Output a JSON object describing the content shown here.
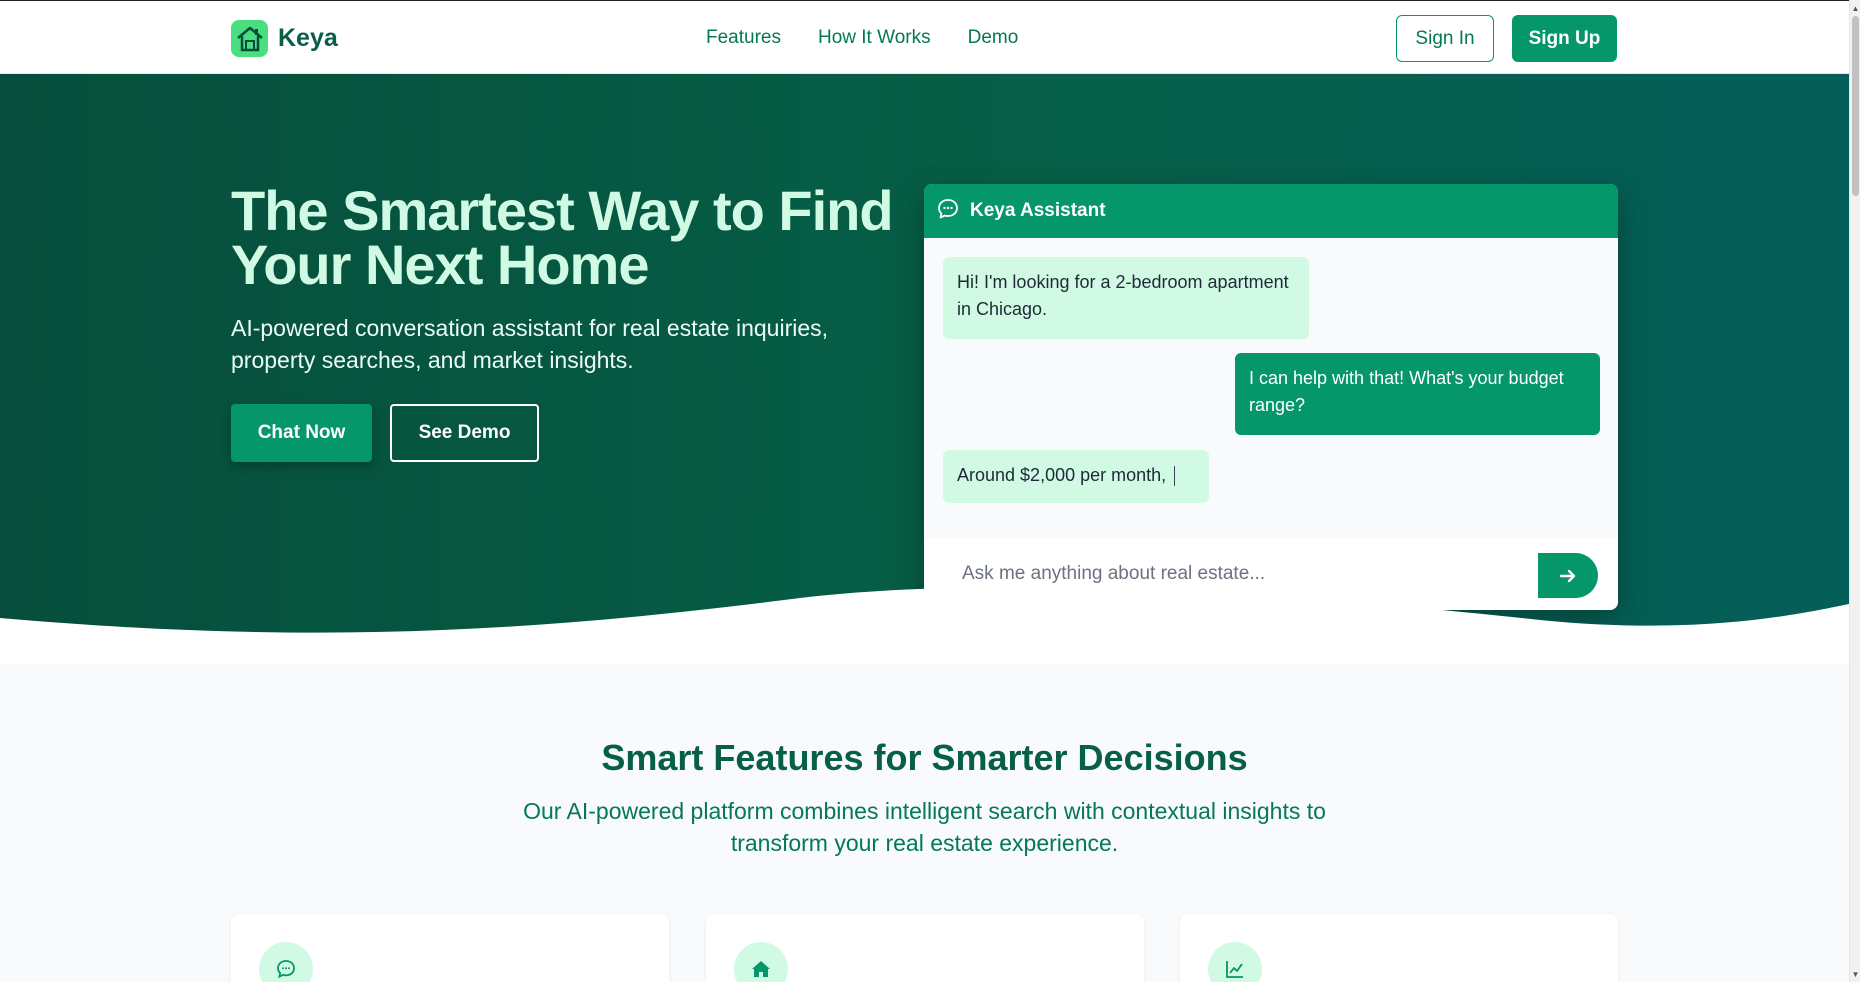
{
  "brand": {
    "name": "Keya",
    "logo_icon": "house-logo-icon"
  },
  "nav": {
    "links": [
      "Features",
      "How It Works",
      "Demo"
    ],
    "sign_in": "Sign In",
    "sign_up": "Sign Up"
  },
  "hero": {
    "title": "The Smartest Way to Find Your Next Home",
    "subtitle": "AI-powered conversation assistant for real estate inquiries, property searches, and market insights.",
    "cta_primary": "Chat Now",
    "cta_secondary": "See Demo"
  },
  "chat": {
    "title": "Keya Assistant",
    "messages": [
      {
        "role": "user",
        "text": "Hi! I'm looking for a 2-bedroom apartment in Chicago."
      },
      {
        "role": "assistant",
        "text": "I can help with that! What's your budget range?"
      },
      {
        "role": "user",
        "text": "Around $2,000 per month,"
      }
    ],
    "input_placeholder": "Ask me anything about real estate..."
  },
  "features": {
    "title": "Smart Features for Smarter Decisions",
    "subtitle_line1": "Our AI-powered platform combines intelligent search with contextual insights to",
    "subtitle_line2": "transform your real estate experience.",
    "cards": [
      {
        "icon": "chat-bubble-icon"
      },
      {
        "icon": "home-icon"
      },
      {
        "icon": "chart-line-icon"
      }
    ]
  },
  "colors": {
    "primary": "#059669",
    "hero_dark": "#064e3b",
    "mint": "#d1fae5",
    "text_dark": "#065f46"
  }
}
